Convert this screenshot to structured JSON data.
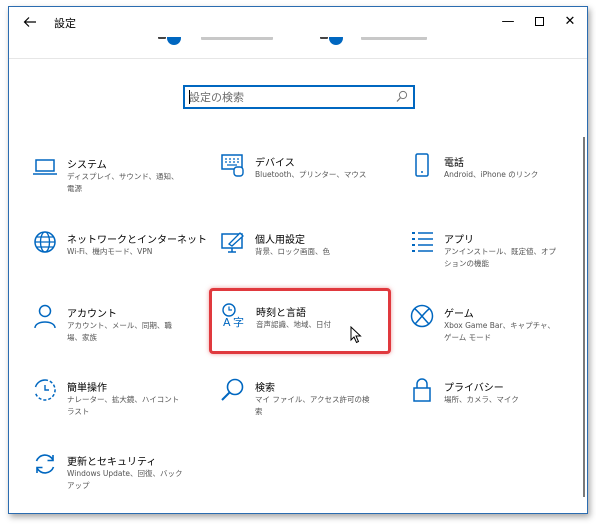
{
  "window": {
    "title": "設定",
    "back_icon": "arrow-left-icon",
    "controls": {
      "minimize": "—",
      "close": "✕"
    }
  },
  "search": {
    "placeholder": "設定の検索",
    "icon": "search-icon"
  },
  "colors": {
    "accent": "#0067c0",
    "highlight": "#e0393e",
    "secondary_text": "#555555"
  },
  "categories": [
    {
      "name": "システム",
      "desc": "ディスプレイ、サウンド、通知、電源",
      "icon": "laptop-icon"
    },
    {
      "name": "デバイス",
      "desc": "Bluetooth、プリンター、マウス",
      "icon": "keyboard-icon"
    },
    {
      "name": "電話",
      "desc": "Android、iPhone のリンク",
      "icon": "phone-icon"
    },
    {
      "name": "ネットワークとインターネット",
      "desc": "Wi-Fi、機内モード、VPN",
      "icon": "globe-icon"
    },
    {
      "name": "個人用設定",
      "desc": "背景、ロック画面、色",
      "icon": "personalize-icon"
    },
    {
      "name": "アプリ",
      "desc": "アンインストール、既定値、オプションの機能",
      "icon": "apps-list-icon"
    },
    {
      "name": "アカウント",
      "desc": "アカウント、メール、同期、職場、家族",
      "icon": "person-icon"
    },
    {
      "name": "時刻と言語",
      "desc": "音声認識、地域、日付",
      "icon": "time-language-icon"
    },
    {
      "name": "ゲーム",
      "desc": "Xbox Game Bar、キャプチャ、ゲーム モード",
      "icon": "xbox-icon"
    },
    {
      "name": "簡単操作",
      "desc": "ナレーター、拡大鏡、ハイコントラスト",
      "icon": "ease-of-access-icon"
    },
    {
      "name": "検索",
      "desc": "マイ ファイル、アクセス許可の検索",
      "icon": "magnifier-icon"
    },
    {
      "name": "プライバシー",
      "desc": "場所、カメラ、マイク",
      "icon": "lock-icon"
    },
    {
      "name": "更新とセキュリティ",
      "desc": "Windows Update、回復、バックアップ",
      "icon": "sync-icon"
    }
  ]
}
